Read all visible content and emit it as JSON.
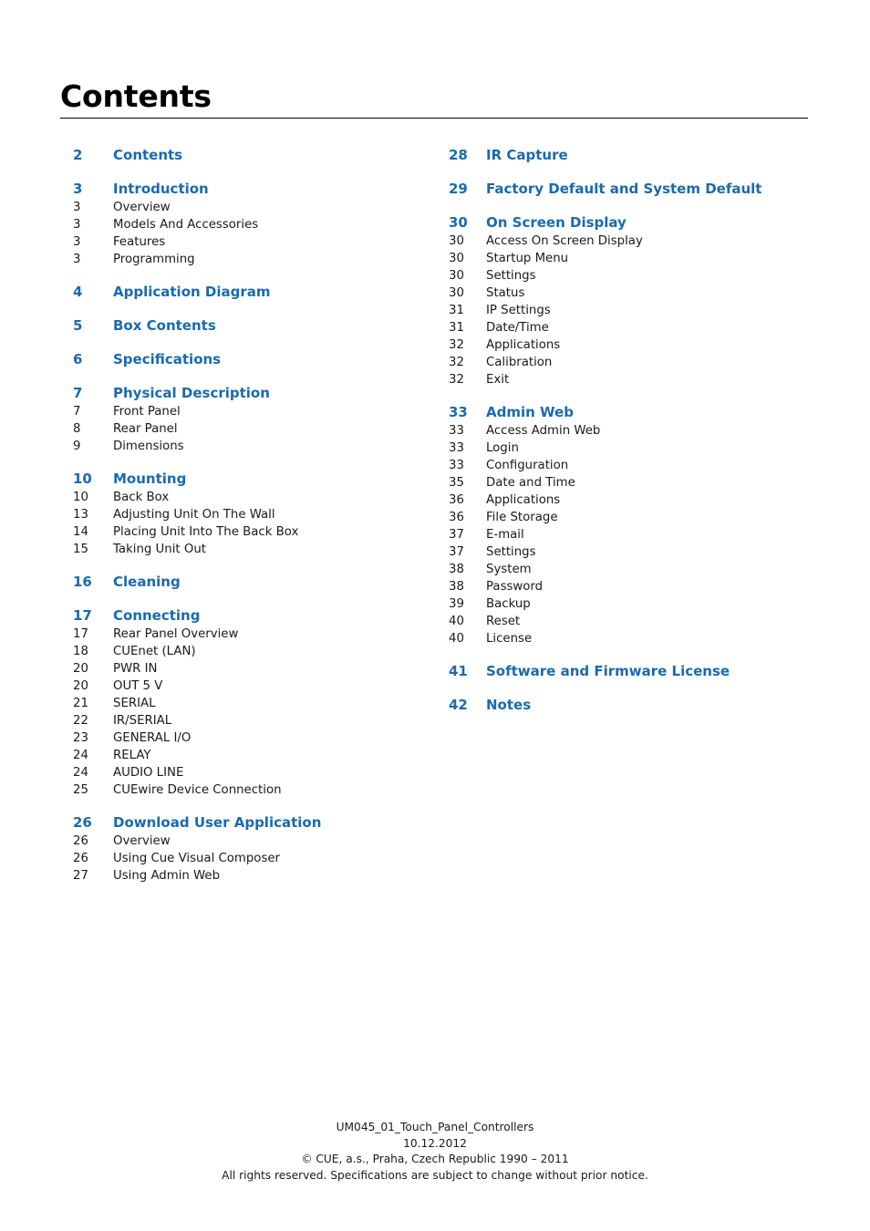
{
  "document": {
    "title": "Contents",
    "accent_color": "#1A6AAF",
    "text_color": "#1a1a1a"
  },
  "toc": {
    "left_column": [
      {
        "type": "chapter",
        "page": "2",
        "label": "Contents"
      },
      {
        "type": "chapter",
        "page": "3",
        "label": "Introduction"
      },
      {
        "type": "item",
        "page": "3",
        "label": "Overview"
      },
      {
        "type": "item",
        "page": "3",
        "label": "Models And Accessories"
      },
      {
        "type": "item",
        "page": "3",
        "label": "Features"
      },
      {
        "type": "item",
        "page": "3",
        "label": "Programming"
      },
      {
        "type": "chapter",
        "page": "4",
        "label": "Application Diagram"
      },
      {
        "type": "chapter",
        "page": "5",
        "label": "Box Contents"
      },
      {
        "type": "chapter",
        "page": "6",
        "label": "Specifications"
      },
      {
        "type": "chapter",
        "page": "7",
        "label": "Physical Description"
      },
      {
        "type": "item",
        "page": "7",
        "label": "Front Panel"
      },
      {
        "type": "item",
        "page": "8",
        "label": "Rear Panel"
      },
      {
        "type": "item",
        "page": "9",
        "label": "Dimensions"
      },
      {
        "type": "chapter",
        "page": "10",
        "label": "Mounting"
      },
      {
        "type": "item",
        "page": "10",
        "label": "Back Box"
      },
      {
        "type": "item",
        "page": "13",
        "label": "Adjusting Unit On The Wall"
      },
      {
        "type": "item",
        "page": "14",
        "label": "Placing Unit Into The Back Box"
      },
      {
        "type": "item",
        "page": "15",
        "label": "Taking Unit Out"
      },
      {
        "type": "chapter",
        "page": "16",
        "label": "Cleaning"
      },
      {
        "type": "chapter",
        "page": "17",
        "label": "Connecting"
      },
      {
        "type": "item",
        "page": "17",
        "label": "Rear Panel Overview"
      },
      {
        "type": "item",
        "page": "18",
        "label": "CUEnet (LAN)"
      },
      {
        "type": "item",
        "page": "20",
        "label": "PWR IN"
      },
      {
        "type": "item",
        "page": "20",
        "label": "OUT 5 V"
      },
      {
        "type": "item",
        "page": "21",
        "label": "SERIAL"
      },
      {
        "type": "item",
        "page": "22",
        "label": "IR/SERIAL"
      },
      {
        "type": "item",
        "page": "23",
        "label": "GENERAL I/O"
      },
      {
        "type": "item",
        "page": "24",
        "label": "RELAY"
      },
      {
        "type": "item",
        "page": "24",
        "label": "AUDIO LINE"
      },
      {
        "type": "item",
        "page": "25",
        "label": "CUEwire Device Connection"
      },
      {
        "type": "chapter",
        "page": "26",
        "label": "Download User Application"
      },
      {
        "type": "item",
        "page": "26",
        "label": "Overview"
      },
      {
        "type": "item",
        "page": "26",
        "label": "Using Cue Visual Composer"
      },
      {
        "type": "item",
        "page": "27",
        "label": "Using Admin Web"
      }
    ],
    "right_column": [
      {
        "type": "chapter",
        "page": "28",
        "label": "IR Capture"
      },
      {
        "type": "chapter",
        "page": "29",
        "label": "Factory Default and System Default"
      },
      {
        "type": "chapter",
        "page": "30",
        "label": "On Screen Display"
      },
      {
        "type": "item",
        "page": "30",
        "label": "Access On Screen Display"
      },
      {
        "type": "item",
        "page": "30",
        "label": "Startup Menu"
      },
      {
        "type": "item",
        "page": "30",
        "label": "Settings"
      },
      {
        "type": "item",
        "page": "30",
        "label": "Status"
      },
      {
        "type": "item",
        "page": "31",
        "label": "IP Settings"
      },
      {
        "type": "item",
        "page": "31",
        "label": "Date/Time"
      },
      {
        "type": "item",
        "page": "32",
        "label": "Applications"
      },
      {
        "type": "item",
        "page": "32",
        "label": "Calibration"
      },
      {
        "type": "item",
        "page": "32",
        "label": "Exit"
      },
      {
        "type": "chapter",
        "page": "33",
        "label": "Admin Web"
      },
      {
        "type": "item",
        "page": "33",
        "label": "Access Admin Web"
      },
      {
        "type": "item",
        "page": "33",
        "label": "Login"
      },
      {
        "type": "item",
        "page": "33",
        "label": "Configuration"
      },
      {
        "type": "item",
        "page": "35",
        "label": "Date and Time"
      },
      {
        "type": "item",
        "page": "36",
        "label": "Applications"
      },
      {
        "type": "item",
        "page": "36",
        "label": "File Storage"
      },
      {
        "type": "item",
        "page": "37",
        "label": "E-mail"
      },
      {
        "type": "item",
        "page": "37",
        "label": "Settings"
      },
      {
        "type": "item",
        "page": "38",
        "label": "System"
      },
      {
        "type": "item",
        "page": "38",
        "label": "Password"
      },
      {
        "type": "item",
        "page": "39",
        "label": "Backup"
      },
      {
        "type": "item",
        "page": "40",
        "label": "Reset"
      },
      {
        "type": "item",
        "page": "40",
        "label": "License"
      },
      {
        "type": "chapter",
        "page": "41",
        "label": "Software and Firmware License"
      },
      {
        "type": "chapter",
        "page": "42",
        "label": "Notes"
      }
    ]
  },
  "footer": {
    "line1": "UM045_01_Touch_Panel_Controllers",
    "line2": "10.12.2012",
    "line3": "© CUE, a.s., Praha, Czech Republic 1990 – 2011",
    "line4": "All rights reserved. Specifications are subject to change without prior notice."
  }
}
